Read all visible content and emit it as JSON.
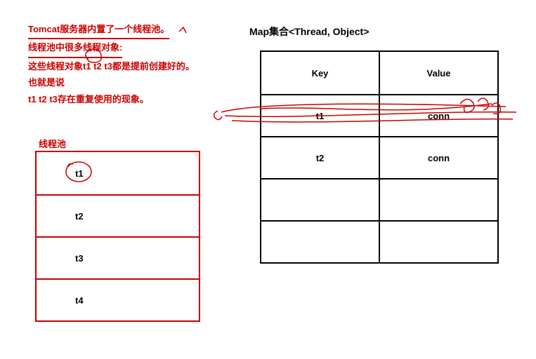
{
  "notes": {
    "line1": "Tomcat服务器内置了一个线程池。",
    "line2": "线程池中很多线程对象:",
    "line3": "这些线程对象t1 t2 t3都是提前创建好的。",
    "line4": "也就是说",
    "line5": "t1 t2 t3存在重复使用的现象。"
  },
  "pool": {
    "label": "线程池",
    "items": [
      "t1",
      "t2",
      "t3",
      "t4"
    ]
  },
  "map": {
    "title": "Map集合<Thread, Object>",
    "header": {
      "key": "Key",
      "value": "Value"
    },
    "rows": [
      {
        "key": "t1",
        "value": "conn"
      },
      {
        "key": "t2",
        "value": "conn"
      },
      {
        "key": "",
        "value": ""
      },
      {
        "key": "",
        "value": ""
      }
    ]
  }
}
